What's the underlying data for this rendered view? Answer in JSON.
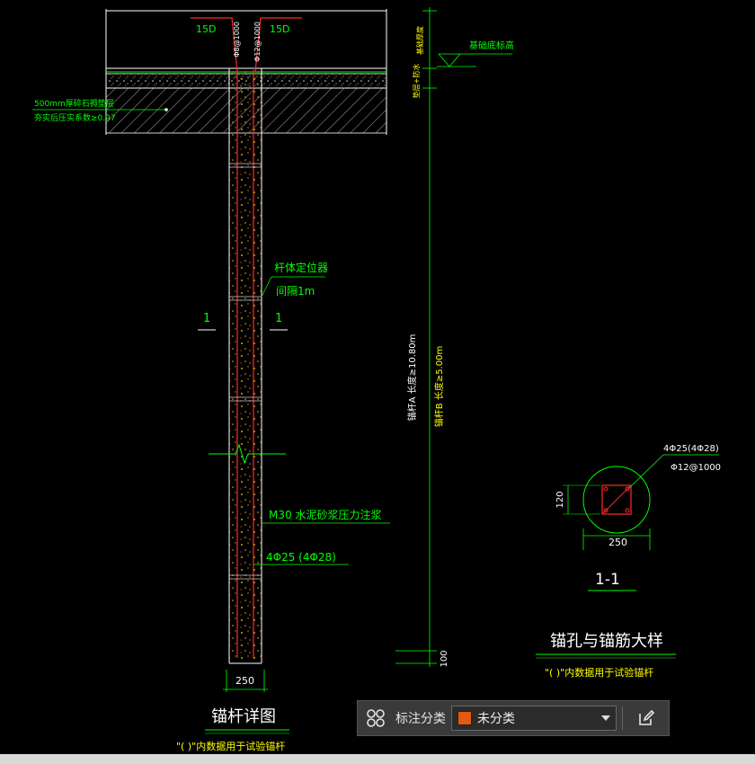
{
  "colors": {
    "background": "#000000",
    "line_white": "#ffffff",
    "line_green": "#00ff00",
    "line_red": "#ff2a2a",
    "text_yellow": "#ffff00",
    "text_white": "#ffffff",
    "text_green": "#00ff00",
    "accent_orange": "#e25a10"
  },
  "drawing": {
    "rebar_left_top": "15D",
    "rebar_right_top": "15D",
    "rebar_vertical_left": "Φ8@1000",
    "rebar_vertical_right": "Φ12@1000",
    "label_foundation_elevation": "基础底标高",
    "label_foundation_thickness": "基础厚度",
    "label_cushion": "垫层+防水",
    "label_gravel_1": "500mm厚碎石褥垫层",
    "label_gravel_2": "夯实后压实系数≥0.97",
    "label_locator_1": "杆体定位器",
    "label_locator_2": "间隔1m",
    "section_mark_left": "1",
    "section_mark_right": "1",
    "label_grout": "M30  水泥砂浆压力注浆",
    "label_bars": "4Φ25 (4Φ28)",
    "label_width_bottom": "250",
    "dim_bottom": "100",
    "dim_length_a": "锚杆A 长度≥10.80m",
    "dim_length_b": "锚杆B 长度≥5.00m",
    "title_anchor_detail": "锚杆详图",
    "note_anchor_detail": "\"( )\"内数据用于试验锚杆",
    "section_bars": "4Φ25(4Φ28)",
    "section_stirrup": "Φ12@1000",
    "section_dim_120": "120",
    "section_dim_250": "250",
    "section_title": "1-1",
    "title_hole_detail": "锚孔与锚筋大样",
    "note_hole_detail": "\"( )\"内数据用于试验锚杆"
  },
  "toolbar": {
    "grid_icon": "four-circles-icon",
    "label": "标注分类",
    "selected": "未分类",
    "edit_icon": "edit-icon"
  }
}
